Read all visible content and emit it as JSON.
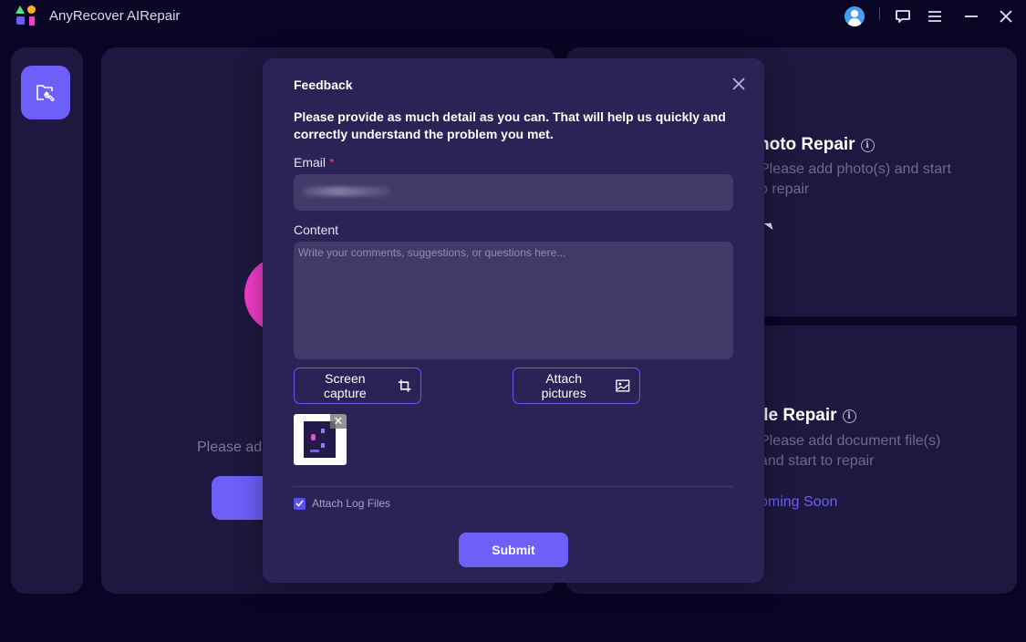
{
  "app": {
    "title": "AnyRecover AIRepair"
  },
  "titlebar": {
    "icons": [
      "user-avatar-icon",
      "feedback-icon",
      "menu-icon",
      "minimize-icon",
      "close-icon"
    ]
  },
  "sidebar": {
    "items": [
      {
        "name": "file-repair",
        "icon": "folder-wrench-icon",
        "active": true
      }
    ]
  },
  "main": {
    "left_panel": {
      "description": "Please add video(s) and start to repair",
      "visible_description": "Please ad"
    },
    "cards": [
      {
        "title": "Photo Repair",
        "visible_title": "hoto Repair",
        "description_lines": [
          "Please add photo(s) and start",
          "to repair"
        ],
        "visible_lines": [
          "Please add photo(s) and start",
          "o repair"
        ]
      },
      {
        "title": "File Repair",
        "visible_title": "ile Repair",
        "description_lines": [
          "Please add document file(s)",
          "and start to repair"
        ],
        "visible_lines": [
          "Please add document file(s)",
          "and start to repair"
        ],
        "status": "Coming Soon",
        "visible_status": "oming Soon"
      }
    ]
  },
  "feedback": {
    "title": "Feedback",
    "intro": "Please provide as much detail as you can. That will help us quickly and correctly understand the problem you met.",
    "email_label": "Email",
    "email_required_mark": "*",
    "email_value_blurred": true,
    "content_label": "Content",
    "content_placeholder": "Write your comments, suggestions, or questions here...",
    "screen_capture_label": "Screen capture",
    "attach_pictures_label": "Attach pictures",
    "attachments_count": 1,
    "attach_log_label": "Attach Log Files",
    "attach_log_checked": true,
    "submit_label": "Submit",
    "thumb_close": "✕"
  },
  "colors": {
    "accent": "#6e5ff8",
    "background": "#090524",
    "panel": "#1e1840",
    "modal": "#2b2255",
    "input": "#413a68",
    "pink": "#f33dc9",
    "required": "#e0457b"
  }
}
